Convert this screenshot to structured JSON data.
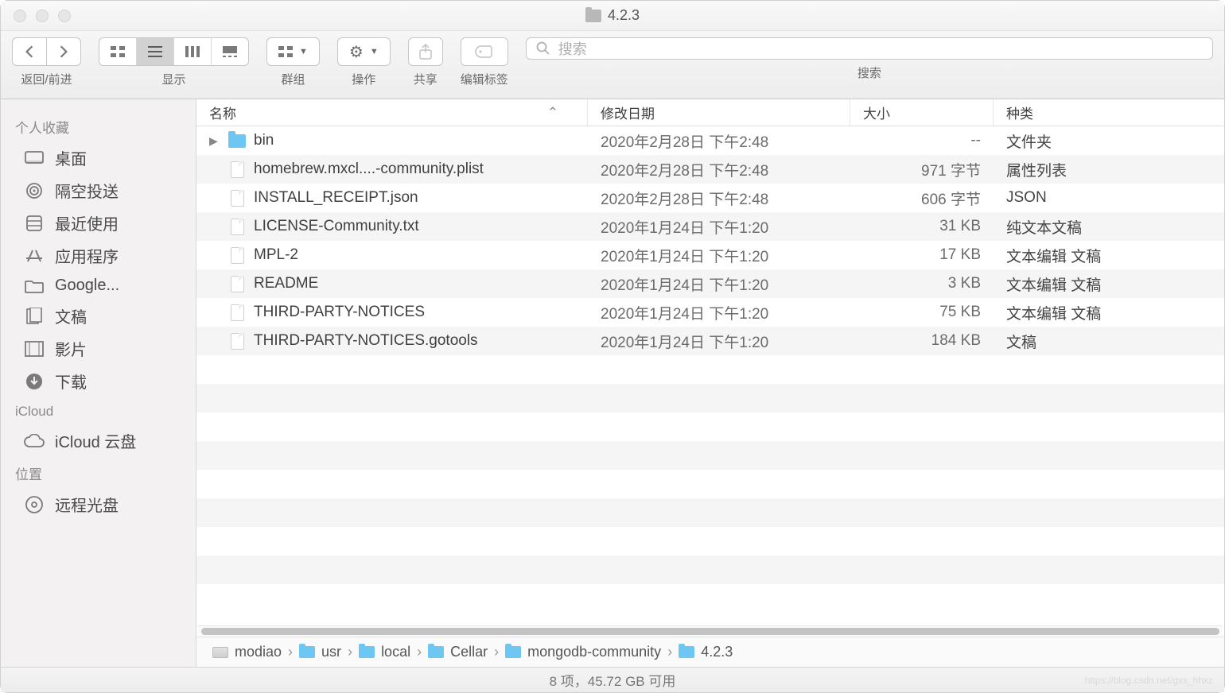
{
  "window": {
    "title": "4.2.3"
  },
  "toolbar": {
    "nav_label": "返回/前进",
    "view_label": "显示",
    "group_label": "群组",
    "action_label": "操作",
    "share_label": "共享",
    "tags_label": "编辑标签",
    "search_label": "搜索",
    "search_placeholder": "搜索"
  },
  "sidebar": {
    "sections": [
      {
        "title": "个人收藏",
        "items": [
          {
            "icon": "desktop",
            "label": "桌面"
          },
          {
            "icon": "airdrop",
            "label": "隔空投送"
          },
          {
            "icon": "recents",
            "label": "最近使用"
          },
          {
            "icon": "apps",
            "label": "应用程序"
          },
          {
            "icon": "folder",
            "label": "Google..."
          },
          {
            "icon": "docs",
            "label": "文稿"
          },
          {
            "icon": "movies",
            "label": "影片"
          },
          {
            "icon": "downloads",
            "label": "下载"
          }
        ]
      },
      {
        "title": "iCloud",
        "items": [
          {
            "icon": "cloud",
            "label": "iCloud 云盘"
          }
        ]
      },
      {
        "title": "位置",
        "items": [
          {
            "icon": "remotedisc",
            "label": "远程光盘"
          }
        ]
      }
    ]
  },
  "columns": {
    "name": "名称",
    "date": "修改日期",
    "size": "大小",
    "kind": "种类"
  },
  "files": [
    {
      "type": "folder",
      "name": "bin",
      "date": "2020年2月28日 下午2:48",
      "size": "--",
      "kind": "文件夹"
    },
    {
      "type": "file",
      "name": "homebrew.mxcl....-community.plist",
      "date": "2020年2月28日 下午2:48",
      "size": "971 字节",
      "kind": "属性列表"
    },
    {
      "type": "file",
      "name": "INSTALL_RECEIPT.json",
      "date": "2020年2月28日 下午2:48",
      "size": "606 字节",
      "kind": "JSON"
    },
    {
      "type": "file",
      "name": "LICENSE-Community.txt",
      "date": "2020年1月24日 下午1:20",
      "size": "31 KB",
      "kind": "纯文本文稿"
    },
    {
      "type": "file",
      "name": "MPL-2",
      "date": "2020年1月24日 下午1:20",
      "size": "17 KB",
      "kind": "文本编辑 文稿"
    },
    {
      "type": "file",
      "name": "README",
      "date": "2020年1月24日 下午1:20",
      "size": "3 KB",
      "kind": "文本编辑 文稿"
    },
    {
      "type": "file",
      "name": "THIRD-PARTY-NOTICES",
      "date": "2020年1月24日 下午1:20",
      "size": "75 KB",
      "kind": "文本编辑 文稿"
    },
    {
      "type": "file",
      "name": "THIRD-PARTY-NOTICES.gotools",
      "date": "2020年1月24日 下午1:20",
      "size": "184 KB",
      "kind": "文稿"
    }
  ],
  "path": [
    {
      "icon": "disk",
      "label": "modiao"
    },
    {
      "icon": "folder",
      "label": "usr"
    },
    {
      "icon": "folder",
      "label": "local"
    },
    {
      "icon": "folder",
      "label": "Cellar"
    },
    {
      "icon": "folder",
      "label": "mongodb-community"
    },
    {
      "icon": "folder",
      "label": "4.2.3"
    }
  ],
  "status": "8 项，45.72 GB 可用",
  "watermark": "https://blog.csdn.net/gxs_hhxz"
}
